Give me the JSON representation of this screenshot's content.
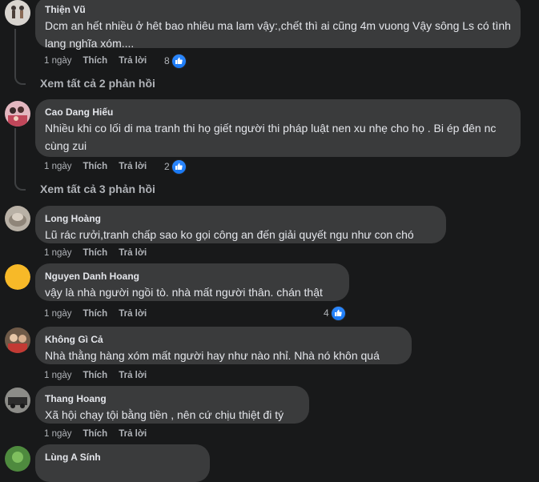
{
  "comments": [
    {
      "name": "Thiện Vũ",
      "text": "Dcm an hết nhiều ở hêt bao nhiêu ma lam vậy:,chết thì ai cũng 4m vuong Vậy sông Ls có tình lang nghĩa xóm....",
      "time": "1 ngày",
      "like": "Thích",
      "reply": "Trả lời",
      "reactions": "8"
    },
    {
      "name": "Cao Dang Hiếu",
      "text": "Nhiều khi co lối di ma tranh thi họ giết người thi pháp luật nen xu nhẹ cho họ . Bi ép đên nc cùng zui",
      "time": "1 ngày",
      "like": "Thích",
      "reply": "Trả lời",
      "reactions": "2"
    },
    {
      "name": "Long Hoàng",
      "text": "Lũ rác rưởi,tranh chấp sao ko gọi công an đến giải quyết ngu như con chó",
      "time": "1 ngày",
      "like": "Thích",
      "reply": "Trả lời",
      "reactions": ""
    },
    {
      "name": "Nguyen Danh Hoang",
      "text": "vậy là nhà người ngồi tò. nhà mất người thân. chán thật",
      "time": "1 ngày",
      "like": "Thích",
      "reply": "Trả lời",
      "reactions": "4"
    },
    {
      "name": "Không Gì Cả",
      "text": "Nhà thằng hàng xóm mất người hay như nào nhỉ. Nhà nó khôn quá",
      "time": "1 ngày",
      "like": "Thích",
      "reply": "Trả lời",
      "reactions": ""
    },
    {
      "name": "Thang Hoang",
      "text": "Xã hội chạy tội bằng tiền , nên cứ chịu thiệt đi tý",
      "time": "1 ngày",
      "like": "Thích",
      "reply": "Trả lời",
      "reactions": ""
    },
    {
      "name": "Lùng A Sính",
      "text": "",
      "time": "",
      "like": "",
      "reply": "",
      "reactions": ""
    }
  ],
  "replies": [
    {
      "label": "Xem tất cả 2 phản hồi"
    },
    {
      "label": "Xem tất cả 3 phản hồi"
    }
  ],
  "colors": {
    "background": "#18191a",
    "bubble": "#3a3b3c",
    "like": "#1877f2",
    "secondary": "#b0b3b8"
  }
}
